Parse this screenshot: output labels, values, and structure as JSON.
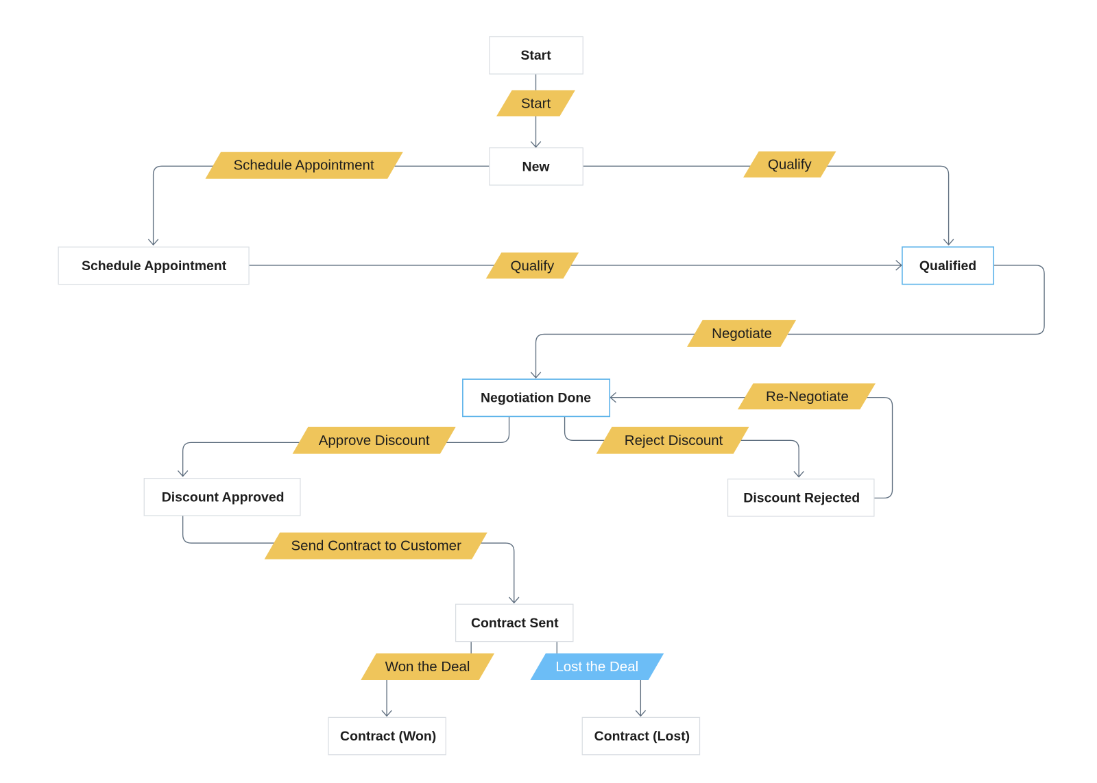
{
  "colors": {
    "transition": "#efc55b",
    "transition_highlight": "#6cbdf6",
    "state_highlight_border": "#5cb3ea",
    "connector": "#5d6d7e"
  },
  "states": {
    "start": "Start",
    "new": "New",
    "schedule_appointment": "Schedule Appointment",
    "qualified": "Qualified",
    "negotiation_done": "Negotiation Done",
    "discount_approved": "Discount Approved",
    "discount_rejected": "Discount Rejected",
    "contract_sent": "Contract Sent",
    "contract_won": "Contract (Won)",
    "contract_lost": "Contract (Lost)"
  },
  "transitions": {
    "start": "Start",
    "schedule_appointment": "Schedule Appointment",
    "qualify_from_new": "Qualify",
    "qualify_from_appointment": "Qualify",
    "negotiate": "Negotiate",
    "re_negotiate": "Re-Negotiate",
    "approve_discount": "Approve Discount",
    "reject_discount": "Reject Discount",
    "send_contract": "Send Contract to Customer",
    "won_the_deal": "Won the Deal",
    "lost_the_deal": "Lost the Deal"
  }
}
